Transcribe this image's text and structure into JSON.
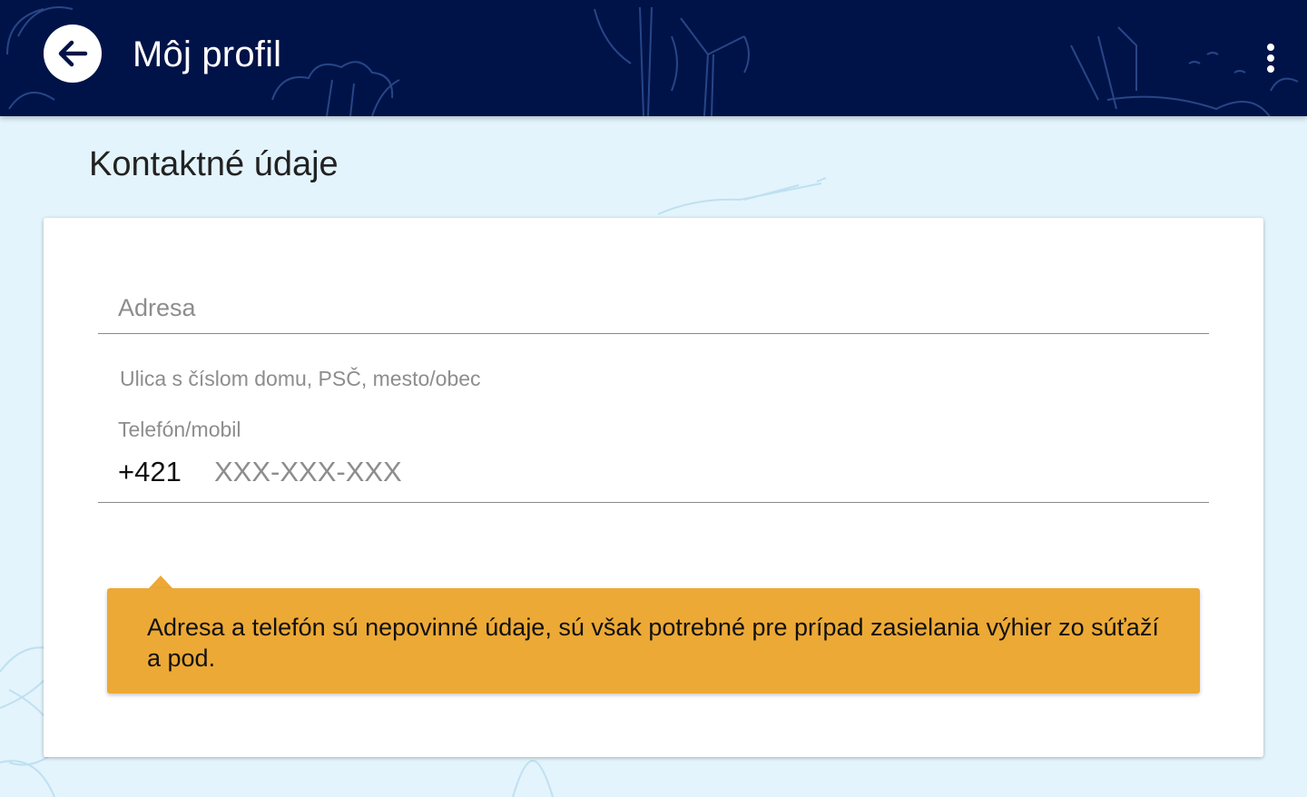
{
  "header": {
    "title": "Môj profil",
    "back_icon": "arrow-left-icon",
    "menu_icon": "more-vertical-icon",
    "background_color": "#001348"
  },
  "section": {
    "title": "Kontaktné údaje"
  },
  "form": {
    "address": {
      "placeholder": "Adresa",
      "value": "",
      "hint": "Ulica s číslom domu, PSČ, mesto/obec"
    },
    "phone": {
      "label": "Telefón/mobil",
      "prefix": "+421",
      "placeholder": "XXX-XXX-XXX",
      "value": ""
    }
  },
  "notice": {
    "text": "Adresa a telefón sú nepovinné údaje, sú však potrebné pre prípad zasielania výhier zo súťaží a pod.",
    "color": "#eca935"
  },
  "colors": {
    "page_background": "#e3f4fc",
    "card_background": "#ffffff"
  }
}
